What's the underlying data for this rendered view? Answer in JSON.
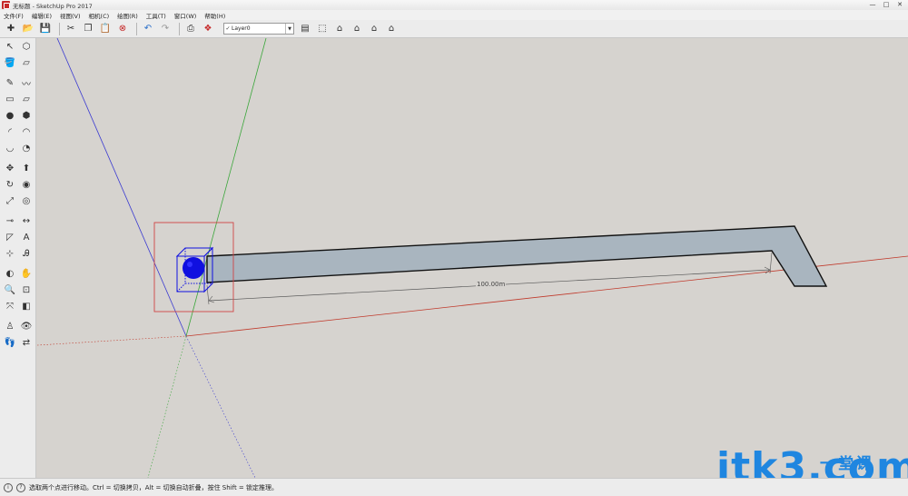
{
  "window": {
    "title": "无标题 - SketchUp Pro 2017",
    "controls": {
      "minimize": "—",
      "maximize": "□",
      "close": "✕"
    }
  },
  "menu": [
    "文件(F)",
    "编辑(E)",
    "视图(V)",
    "相机(C)",
    "绘图(R)",
    "工具(T)",
    "窗口(W)",
    "帮助(H)"
  ],
  "toolbar": {
    "group1": [
      {
        "name": "new-file-icon",
        "glyph": "✚"
      },
      {
        "name": "open-file-icon",
        "glyph": "📂"
      },
      {
        "name": "save-icon",
        "glyph": "💾"
      }
    ],
    "group2": [
      {
        "name": "cut-icon",
        "glyph": "✂"
      },
      {
        "name": "copy-icon",
        "glyph": "❐"
      },
      {
        "name": "paste-icon",
        "glyph": "📋"
      },
      {
        "name": "erase-icon",
        "glyph": "⊗"
      }
    ],
    "group3": [
      {
        "name": "undo-icon",
        "glyph": "↶"
      },
      {
        "name": "redo-icon",
        "glyph": "↷"
      }
    ],
    "group4": [
      {
        "name": "print-icon",
        "glyph": "⎙"
      },
      {
        "name": "model-info-icon",
        "glyph": "❖"
      }
    ],
    "layer": {
      "check": "✓",
      "name": "Layer0",
      "arrow": "▼"
    },
    "group5": [
      {
        "name": "layer-manager-icon",
        "glyph": "▤"
      },
      {
        "name": "iso-view-icon",
        "glyph": "⬚"
      },
      {
        "name": "top-view-icon",
        "glyph": "⌂"
      },
      {
        "name": "front-view-icon",
        "glyph": "⌂"
      },
      {
        "name": "right-view-icon",
        "glyph": "⌂"
      },
      {
        "name": "back-view-icon",
        "glyph": "⌂"
      }
    ]
  },
  "tools": [
    [
      {
        "name": "select-icon",
        "glyph": "↖"
      },
      {
        "name": "make-component-icon",
        "glyph": "⬡"
      }
    ],
    [
      {
        "name": "paint-bucket-icon",
        "glyph": "🪣"
      },
      {
        "name": "eraser-icon",
        "glyph": "▱"
      }
    ],
    "gap",
    [
      {
        "name": "line-icon",
        "glyph": "✎"
      },
      {
        "name": "freehand-icon",
        "glyph": "〰"
      }
    ],
    [
      {
        "name": "rectangle-icon",
        "glyph": "▭"
      },
      {
        "name": "rotated-rectangle-icon",
        "glyph": "▱"
      }
    ],
    [
      {
        "name": "circle-icon",
        "glyph": "●"
      },
      {
        "name": "polygon-icon",
        "glyph": "⬢"
      }
    ],
    [
      {
        "name": "arc-icon",
        "glyph": "◜"
      },
      {
        "name": "two-point-arc-icon",
        "glyph": "◠"
      }
    ],
    [
      {
        "name": "three-point-arc-icon",
        "glyph": "◡"
      },
      {
        "name": "pie-icon",
        "glyph": "◔"
      }
    ],
    "gap",
    [
      {
        "name": "move-icon",
        "glyph": "✥"
      },
      {
        "name": "push-pull-icon",
        "glyph": "⬆"
      }
    ],
    [
      {
        "name": "rotate-icon",
        "glyph": "↻"
      },
      {
        "name": "follow-me-icon",
        "glyph": "◉"
      }
    ],
    [
      {
        "name": "scale-icon",
        "glyph": "⤢"
      },
      {
        "name": "offset-icon",
        "glyph": "◎"
      }
    ],
    "gap",
    [
      {
        "name": "tape-measure-icon",
        "glyph": "⊸"
      },
      {
        "name": "dimension-icon",
        "glyph": "↔"
      }
    ],
    [
      {
        "name": "protractor-icon",
        "glyph": "◸"
      },
      {
        "name": "text-icon",
        "glyph": "A"
      }
    ],
    [
      {
        "name": "axes-icon",
        "glyph": "⊹"
      },
      {
        "name": "3d-text-icon",
        "glyph": "Ꭿ"
      }
    ],
    "gap",
    [
      {
        "name": "orbit-icon",
        "glyph": "◐"
      },
      {
        "name": "pan-icon",
        "glyph": "✋"
      }
    ],
    [
      {
        "name": "zoom-icon",
        "glyph": "🔍"
      },
      {
        "name": "zoom-window-icon",
        "glyph": "⊡"
      }
    ],
    [
      {
        "name": "zoom-extents-icon",
        "glyph": "⤧"
      },
      {
        "name": "previous-view-icon",
        "glyph": "◧"
      }
    ],
    "gap",
    [
      {
        "name": "position-camera-icon",
        "glyph": "♙"
      },
      {
        "name": "look-around-icon",
        "glyph": "👁"
      }
    ],
    [
      {
        "name": "walk-icon",
        "glyph": "👣"
      },
      {
        "name": "section-plane-icon",
        "glyph": "⇄"
      }
    ]
  ],
  "viewport": {
    "dimension": "100.00m"
  },
  "watermark": {
    "text": "itk3",
    "suffix": ".com",
    "cn": "一堂课"
  },
  "status": {
    "icon1": "i",
    "icon2": "?",
    "message": "选取两个点进行移动。Ctrl = 切换拷贝，Alt = 切换自动折叠，按住 Shift = 锁定推理。"
  },
  "colors": {
    "red_axis": "#c0392b",
    "green_axis": "#3aa63a",
    "blue_axis": "#3a3ad0",
    "face": "#a9b5bf",
    "selection": "#1010e0",
    "watermark": "#1f86e0"
  }
}
